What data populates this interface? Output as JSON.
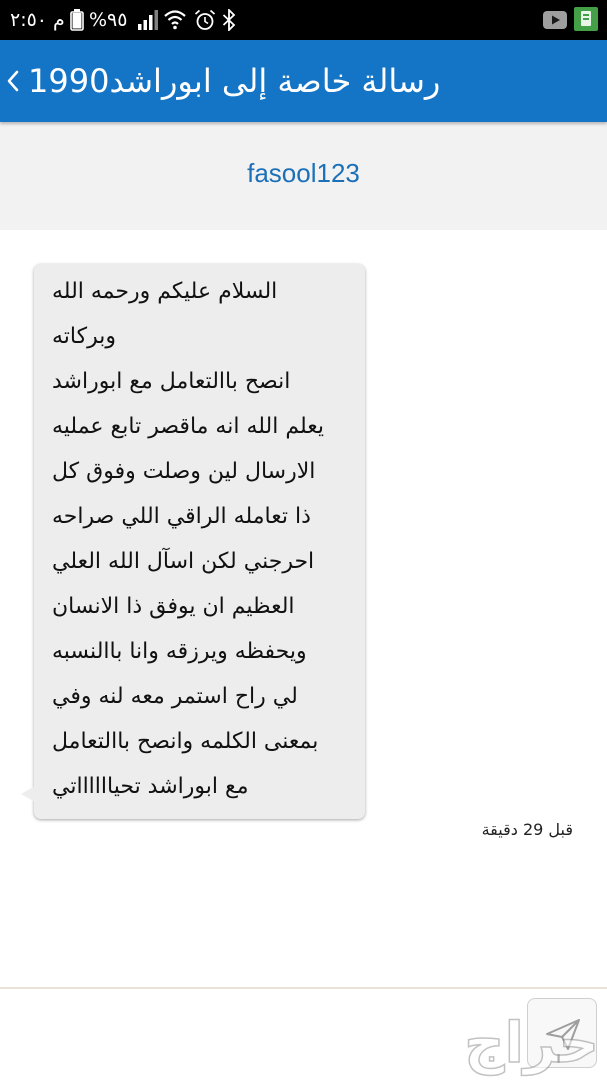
{
  "status_bar": {
    "time": "٢:٥٠ م",
    "battery_percent": "%٩٥",
    "left_icons": [
      "battery-icon",
      "signal-icon",
      "wifi-icon",
      "alarm-icon",
      "bluetooth-icon"
    ],
    "right_icons": [
      "youtube-icon",
      "app-notification-icon"
    ]
  },
  "header": {
    "back_icon": "chevron-left-icon",
    "title": "رسالة خاصة إلى ابوراشد1990",
    "background_color": "#1474c6"
  },
  "recipient": {
    "username": "fasool123",
    "color": "#1b70b8"
  },
  "message": {
    "bubble_color": "#ededed",
    "lines": [
      "السلام عليكم ورحمه الله",
      "وبركاته",
      "انصح باالتعامل مع ابوراشد",
      "يعلم الله انه ماقصر تابع عمليه",
      "الارسال لين وصلت وفوق كل",
      "ذا تعامله الراقي اللي صراحه",
      "احرجني لكن اسآل الله العلي",
      "العظيم ان يوفق ذا الانسان",
      "ويحفظه ويرزقه وانا باالنسبه",
      "لي راح استمر معه لنه وفي",
      "بمعنى الكلمه وانصح باالتعامل",
      "مع ابوراشد تحيااااااتي"
    ],
    "time_ago": "قبل 29 دقيقة"
  },
  "composer": {
    "value": "",
    "send_icon": "send-icon"
  },
  "watermark": {
    "text": "حراج"
  }
}
